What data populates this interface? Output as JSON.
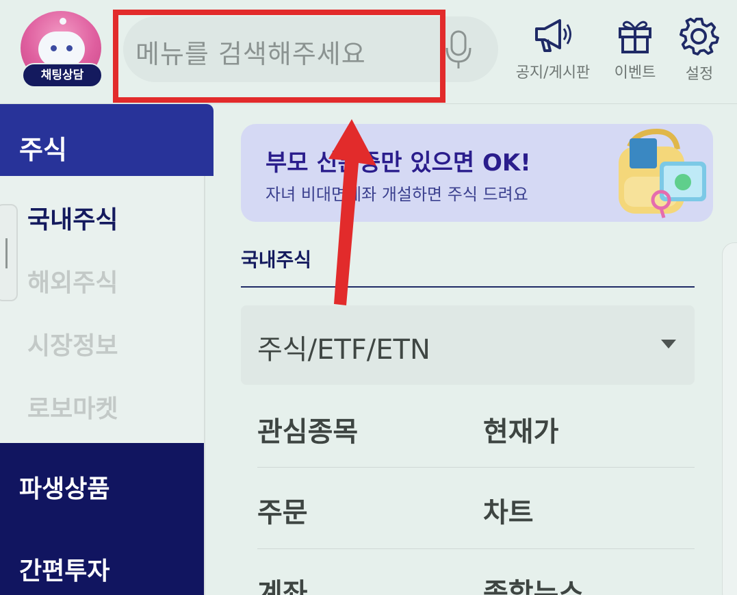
{
  "header": {
    "chat_badge": "채팅상담",
    "search_placeholder": "메뉴를 검색해주세요",
    "buttons": [
      {
        "label": "공지/게시판",
        "icon": "megaphone-icon"
      },
      {
        "label": "이벤트",
        "icon": "gift-icon"
      },
      {
        "label": "설정",
        "icon": "gear-icon"
      }
    ]
  },
  "sidebar": {
    "active_category": "주식",
    "sub_items": [
      "국내주식",
      "해외주식",
      "시장정보",
      "로보마켓"
    ],
    "categories": [
      "파생상품",
      "간편투자"
    ]
  },
  "banner": {
    "title": "부모 신분증만 있으면  OK!",
    "subtitle": "자녀 비대면계좌 개설하면 주식 드려요"
  },
  "main": {
    "tab_title": "국내주식",
    "select_value": "주식/ETF/ETN",
    "menu": [
      [
        "관심종목",
        "현재가"
      ],
      [
        "주문",
        "차트"
      ],
      [
        "계좌",
        "종합뉴스"
      ]
    ]
  },
  "colors": {
    "annotation": "#e22b2b",
    "sidebar_active": "#283399",
    "sidebar_dark": "#111560",
    "banner_bg": "#d5d9f4"
  }
}
